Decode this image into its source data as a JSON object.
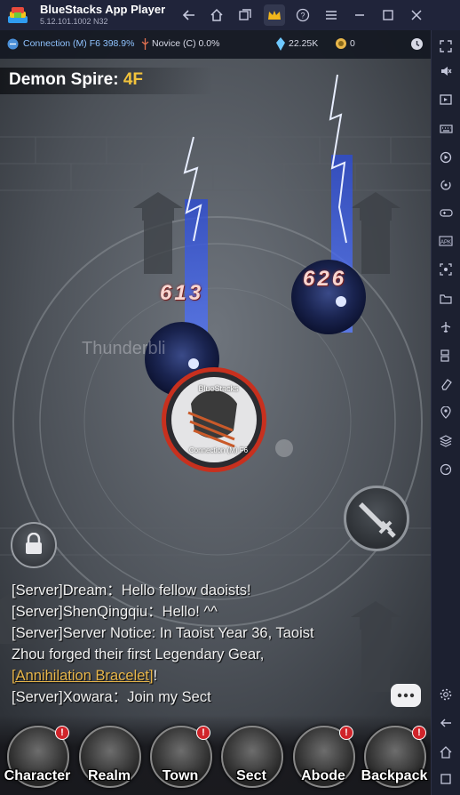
{
  "window": {
    "title": "BlueStacks App Player",
    "version": "5.12.101.1002  N32"
  },
  "titlebar_icons": [
    "back-arrow-icon",
    "home-icon",
    "multi-window-icon",
    "crown-icon",
    "help-icon",
    "menu-icon",
    "minimize-icon",
    "maximize-icon",
    "close-icon"
  ],
  "status": {
    "connection": "Connection (M) F6 398.9%",
    "novice": "Novice (C) 0.0%",
    "currency": "22.25K",
    "coins": "0"
  },
  "stage": {
    "label": "Demon Spire:",
    "floor": "4F"
  },
  "battle": {
    "damage_1": "613",
    "damage_2": "626",
    "skill_name": "Thunderbli",
    "player_name": "BlueStacks",
    "player_sub": "Connection (M) F6"
  },
  "chat": {
    "lines": [
      "[Server]Dream：Hello fellow daoists!",
      "[Server]ShenQingqiu：Hello! ^^",
      "[Server]Server Notice: In Taoist Year 36, Taoist",
      "Zhou forged their first Legendary Gear,",
      "[Annihilation Bracelet]",
      "!",
      "[Server]Xowara：Join my Sect"
    ]
  },
  "nav": {
    "items": [
      {
        "label": "Character",
        "badge": "!"
      },
      {
        "label": "Realm",
        "badge": ""
      },
      {
        "label": "Town",
        "badge": "!"
      },
      {
        "label": "Sect",
        "badge": ""
      },
      {
        "label": "Abode",
        "badge": "!"
      },
      {
        "label": "Backpack",
        "badge": "!"
      }
    ]
  },
  "colors": {
    "accent_floor": "#f2c33c",
    "lightning": "#3b6bff",
    "link": "#e8b64a",
    "badge": "#d0242a"
  },
  "sidebar_icons": [
    "fullscreen-icon",
    "volume-icon",
    "media-icon",
    "keyboard-icon",
    "record-icon",
    "rotate-icon",
    "gamepad-icon",
    "apk-icon",
    "screenshot-icon",
    "folder-icon",
    "airplane-icon",
    "multi-instance-icon",
    "eraser-icon",
    "location-icon",
    "layers-icon",
    "timer-icon",
    "settings-icon",
    "back-icon",
    "home-icon",
    "recents-icon"
  ]
}
